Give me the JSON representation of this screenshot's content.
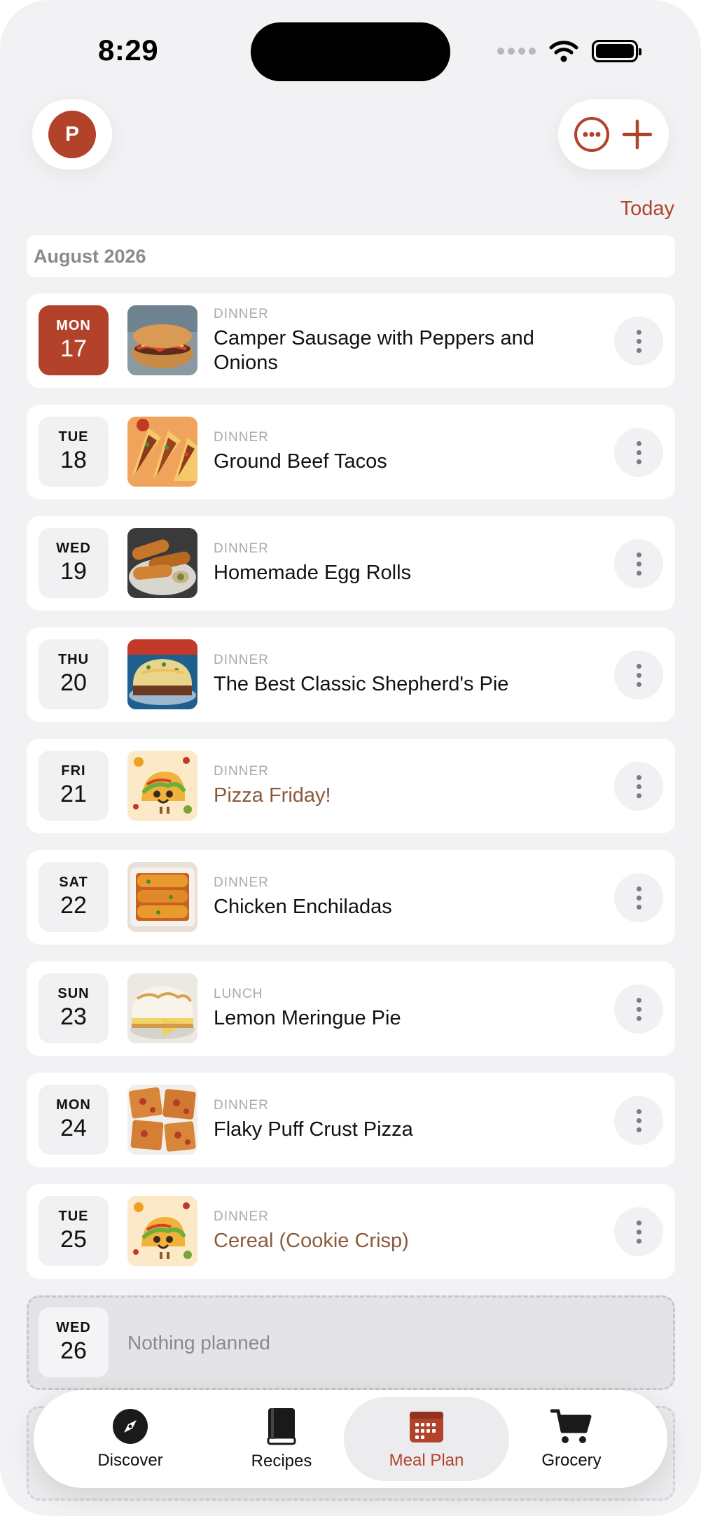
{
  "status_bar": {
    "time": "8:29"
  },
  "header": {
    "avatar_initial": "P",
    "today_label": "Today"
  },
  "month_label": "August 2026",
  "meals": [
    {
      "day": "MON",
      "date": "17",
      "type": "DINNER",
      "title": "Camper Sausage with Peppers and Onions",
      "note": false,
      "active": true,
      "thumb": "sandwich"
    },
    {
      "day": "TUE",
      "date": "18",
      "type": "DINNER",
      "title": "Ground Beef Tacos",
      "note": false,
      "active": false,
      "thumb": "tacos"
    },
    {
      "day": "WED",
      "date": "19",
      "type": "DINNER",
      "title": "Homemade Egg Rolls",
      "note": false,
      "active": false,
      "thumb": "eggrolls"
    },
    {
      "day": "THU",
      "date": "20",
      "type": "DINNER",
      "title": "The Best Classic Shepherd's Pie",
      "note": false,
      "active": false,
      "thumb": "shepherd"
    },
    {
      "day": "FRI",
      "date": "21",
      "type": "DINNER",
      "title": "Pizza Friday!",
      "note": true,
      "active": false,
      "thumb": "taco-cartoon"
    },
    {
      "day": "SAT",
      "date": "22",
      "type": "DINNER",
      "title": "Chicken Enchiladas",
      "note": false,
      "active": false,
      "thumb": "enchiladas"
    },
    {
      "day": "SUN",
      "date": "23",
      "type": "LUNCH",
      "title": "Lemon Meringue Pie",
      "note": false,
      "active": false,
      "thumb": "pie"
    },
    {
      "day": "MON",
      "date": "24",
      "type": "DINNER",
      "title": "Flaky Puff Crust Pizza",
      "note": false,
      "active": false,
      "thumb": "pizza"
    },
    {
      "day": "TUE",
      "date": "25",
      "type": "DINNER",
      "title": "Cereal (Cookie Crisp)",
      "note": true,
      "active": false,
      "thumb": "taco-cartoon"
    }
  ],
  "empty_day": {
    "day": "WED",
    "date": "26",
    "text": "Nothing planned"
  },
  "tabs": [
    {
      "label": "Discover",
      "icon": "compass-icon"
    },
    {
      "label": "Recipes",
      "icon": "book-icon"
    },
    {
      "label": "Meal Plan",
      "icon": "calendar-icon",
      "active": true
    },
    {
      "label": "Grocery",
      "icon": "cart-icon"
    }
  ],
  "colors": {
    "accent": "#b2432a",
    "note_text": "#8b5a3c",
    "background": "#f2f2f4"
  }
}
